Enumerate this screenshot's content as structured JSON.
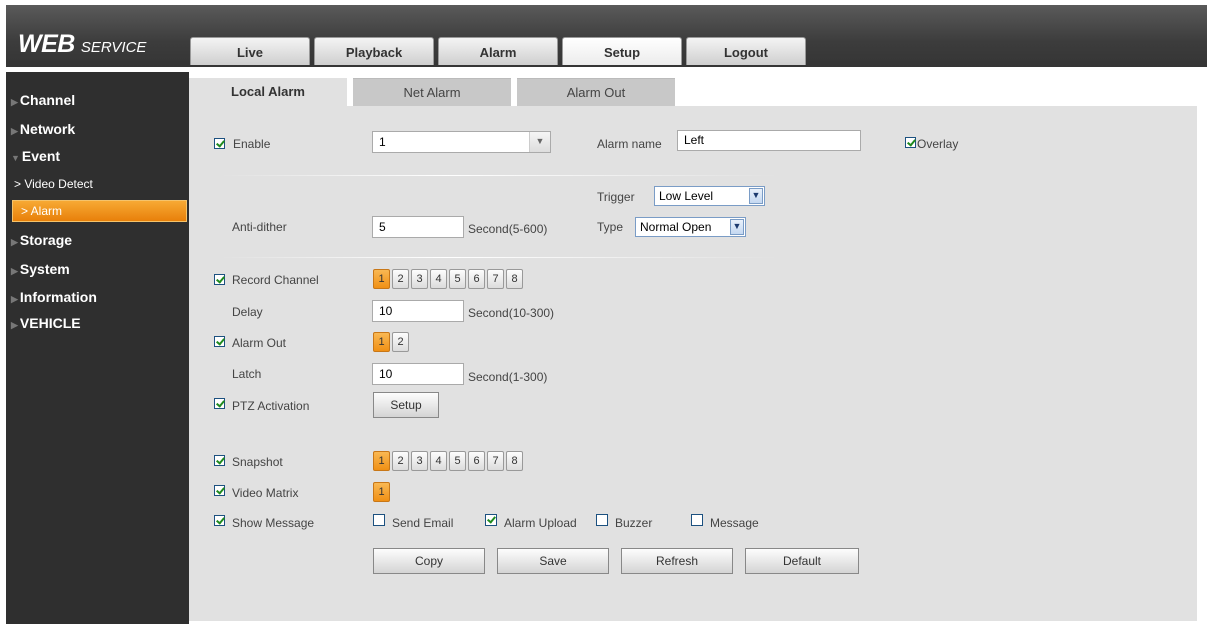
{
  "header": {
    "logo_main": "WEB",
    "logo_sub": "SERVICE",
    "nav": [
      {
        "label": "Live"
      },
      {
        "label": "Playback"
      },
      {
        "label": "Alarm"
      },
      {
        "label": "Setup"
      },
      {
        "label": "Logout"
      }
    ],
    "active_nav": "Setup"
  },
  "sidebar": {
    "items": [
      {
        "label": "Channel"
      },
      {
        "label": "Network"
      },
      {
        "label": "Event"
      },
      {
        "label": "Storage"
      },
      {
        "label": "System"
      },
      {
        "label": "Information"
      },
      {
        "label": "VEHICLE"
      }
    ],
    "event_sub": [
      {
        "label": "> Video Detect"
      },
      {
        "label": "> Alarm"
      }
    ],
    "active_sub": "> Alarm"
  },
  "tabs": [
    {
      "label": "Local Alarm"
    },
    {
      "label": "Net Alarm"
    },
    {
      "label": "Alarm Out"
    }
  ],
  "active_tab": "Local Alarm",
  "form": {
    "enable": {
      "label": "Enable",
      "checked": true,
      "channel": "1"
    },
    "alarm_name": {
      "label": "Alarm name",
      "value": "Left"
    },
    "overlay": {
      "label": "Overlay",
      "checked": true
    },
    "trigger": {
      "label": "Trigger",
      "value": "Low Level"
    },
    "type": {
      "label": "Type",
      "value": "Normal Open"
    },
    "anti_dither": {
      "label": "Anti-dither",
      "value": "5",
      "unit": "Second(5-600)"
    },
    "record_channel": {
      "label": "Record Channel",
      "checked": true,
      "channels": [
        "1",
        "2",
        "3",
        "4",
        "5",
        "6",
        "7",
        "8"
      ],
      "selected": [
        "1"
      ]
    },
    "delay": {
      "label": "Delay",
      "value": "10",
      "unit": "Second(10-300)"
    },
    "alarm_out": {
      "label": "Alarm Out",
      "checked": true,
      "channels": [
        "1",
        "2"
      ],
      "selected": [
        "1"
      ]
    },
    "latch": {
      "label": "Latch",
      "value": "10",
      "unit": "Second(1-300)"
    },
    "ptz_activation": {
      "label": "PTZ Activation",
      "checked": true,
      "button": "Setup"
    },
    "snapshot": {
      "label": "Snapshot",
      "checked": true,
      "channels": [
        "1",
        "2",
        "3",
        "4",
        "5",
        "6",
        "7",
        "8"
      ],
      "selected": [
        "1"
      ]
    },
    "video_matrix": {
      "label": "Video Matrix",
      "checked": true,
      "channels": [
        "1"
      ],
      "selected": [
        "1"
      ]
    },
    "show_message": {
      "label": "Show Message",
      "checked": true
    },
    "send_email": {
      "label": "Send Email",
      "checked": false
    },
    "alarm_upload": {
      "label": "Alarm Upload",
      "checked": true
    },
    "buzzer": {
      "label": "Buzzer",
      "checked": false
    },
    "message": {
      "label": "Message",
      "checked": false
    }
  },
  "buttons": {
    "copy": "Copy",
    "save": "Save",
    "refresh": "Refresh",
    "default": "Default"
  },
  "colors": {
    "accent": "#f09015",
    "sidebar_bg": "#2f2f2f",
    "panel_bg": "#e1e1e1"
  }
}
